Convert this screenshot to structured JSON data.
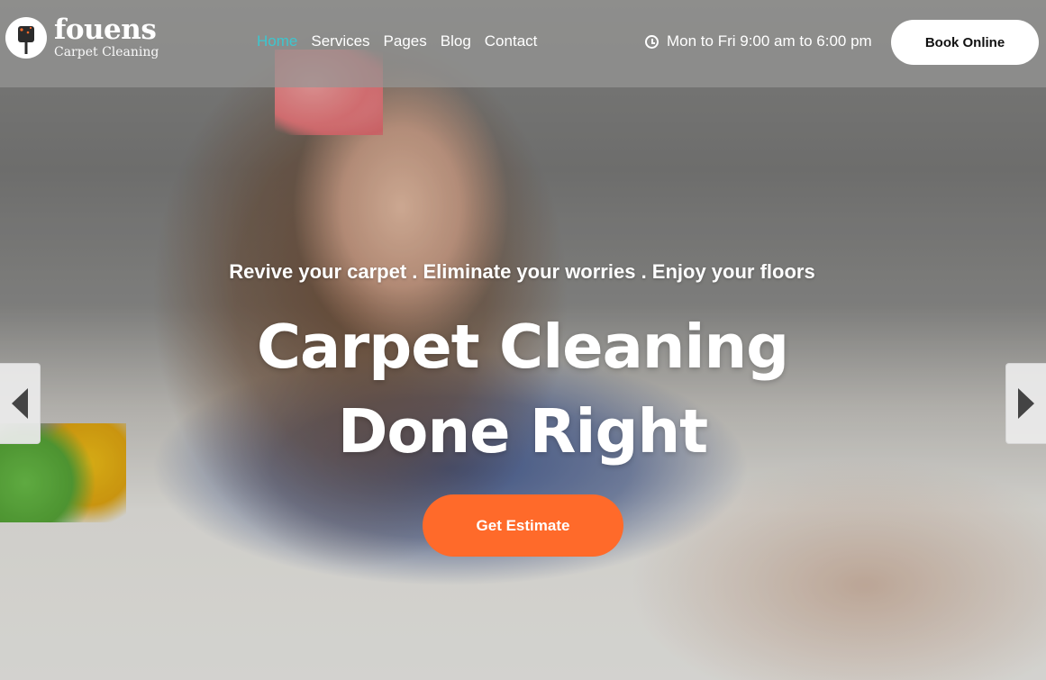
{
  "brand": {
    "name": "fouens",
    "subtitle": "Carpet Cleaning",
    "logo_icon": "vacuum-brush-icon"
  },
  "nav": {
    "items": [
      {
        "label": "Home",
        "active": true
      },
      {
        "label": "Services",
        "active": false
      },
      {
        "label": "Pages",
        "active": false
      },
      {
        "label": "Blog",
        "active": false
      },
      {
        "label": "Contact",
        "active": false
      }
    ]
  },
  "header": {
    "hours": "Mon to Fri 9:00 am to 6:00 pm",
    "hours_icon": "clock-icon",
    "book_label": "Book Online"
  },
  "hero": {
    "tagline": "Revive your carpet . Eliminate your worries . Enjoy your floors",
    "headline_line1": "Carpet Cleaning",
    "headline_line2": "Done Right",
    "cta_label": "Get Estimate",
    "prev_icon": "chevron-left-icon",
    "next_icon": "chevron-right-icon"
  },
  "colors": {
    "accent_nav_active": "#3cc6cf",
    "cta": "#ff6a2a",
    "header_overlay": "#969694"
  }
}
